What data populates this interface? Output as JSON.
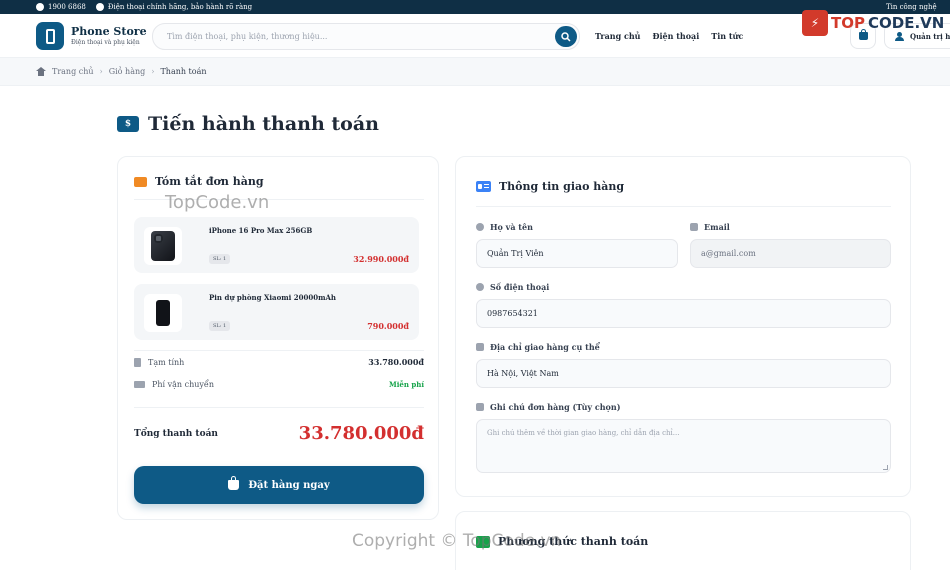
{
  "topbar": {
    "hotline": "1900 6868",
    "guarantee": "Điện thoại chính hãng, bảo hành rõ ràng",
    "tech_news": "Tin công nghệ"
  },
  "header": {
    "brand_name": "Phone Store",
    "brand_tagline": "Điện thoại và phụ kiện",
    "search_placeholder": "Tìm điện thoại, phụ kiện, thương hiệu...",
    "nav": [
      "Trang chủ",
      "Điện thoại",
      "Tin tức"
    ],
    "user_label": "Quản trị h"
  },
  "watermark": {
    "logo_text_top": "TOP",
    "logo_text_code": "CODE.VN",
    "mid": "TopCode.vn",
    "bottom": "Copyright © TopCode.vn"
  },
  "breadcrumb": [
    "Trang chủ",
    "Giỏ hàng",
    "Thanh toán"
  ],
  "page": {
    "title": "Tiến hành thanh toán"
  },
  "summary": {
    "title": "Tóm tắt đơn hàng",
    "items": [
      {
        "name": "iPhone 16 Pro Max 256GB",
        "qty": "SL: 1",
        "price": "32.990.000đ"
      },
      {
        "name": "Pin dự phòng Xiaomi 20000mAh",
        "qty": "SL: 1",
        "price": "790.000đ"
      }
    ],
    "subtotal_label": "Tạm tính",
    "subtotal_value": "33.780.000đ",
    "shipping_label": "Phí vận chuyển",
    "shipping_value": "Miễn phí",
    "total_label": "Tổng thanh toán",
    "total_value": "33.780.000đ",
    "order_button": "Đặt hàng ngay"
  },
  "shipping": {
    "title": "Thông tin giao hàng",
    "name_label": "Họ và tên",
    "name_value": "Quản Trị Viên",
    "email_label": "Email",
    "email_value": "a@gmail.com",
    "phone_label": "Số điện thoại",
    "phone_value": "0987654321",
    "address_label": "Địa chỉ giao hàng cụ thể",
    "address_value": "Hà Nội, Việt Nam",
    "note_label": "Ghi chú đơn hàng (Tùy chọn)",
    "note_placeholder": "Ghi chú thêm về thời gian giao hàng, chỉ dẫn địa chỉ..."
  },
  "payment": {
    "title": "Phương thức thanh toán"
  },
  "colors": {
    "primary": "#0e5a86",
    "price": "#d32f2f",
    "free": "#16a34a",
    "topbar": "#0f2f45"
  }
}
